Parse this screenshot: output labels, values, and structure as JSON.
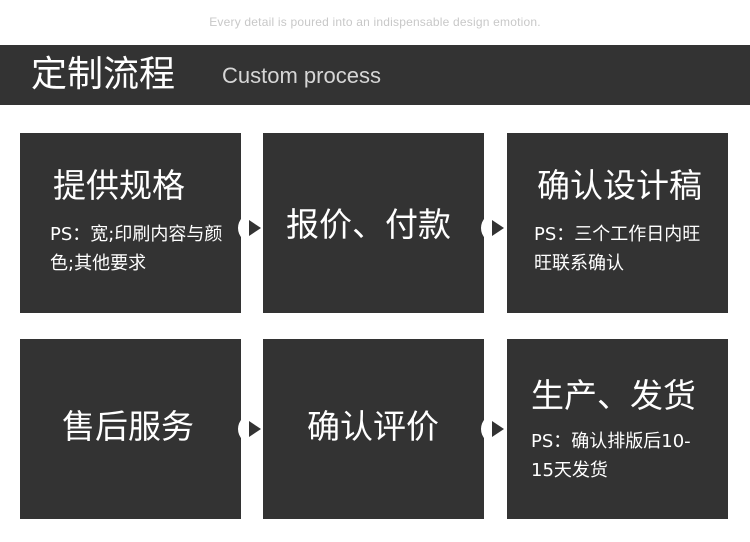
{
  "tagline": "Every detail is poured into an indispensable design emotion.",
  "header": {
    "title_cn": "定制流程",
    "title_en": "Custom process"
  },
  "steps": [
    {
      "title": "提供规格",
      "note": "PS：宽;印刷内容与颜色;其他要求"
    },
    {
      "title": "报价、付款"
    },
    {
      "title": "确认设计稿",
      "note": "PS：三个工作日内旺旺联系确认"
    },
    {
      "title": "售后服务"
    },
    {
      "title": "确认评价"
    },
    {
      "title": "生产、发货",
      "note": "PS：确认排版后10-15天发货"
    }
  ],
  "icons": {
    "arrow": "play-arrow-icon"
  },
  "colors": {
    "card_bg": "#333333",
    "text": "#ffffff"
  }
}
